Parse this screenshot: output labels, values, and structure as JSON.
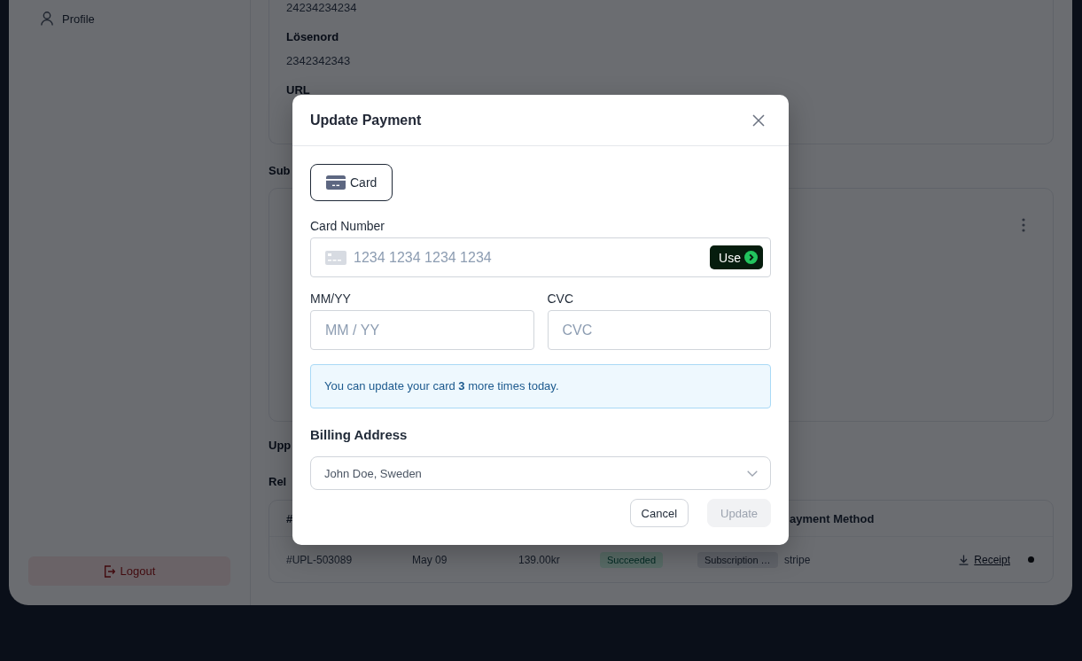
{
  "sidebar": {
    "items": [
      {
        "label": "Profile"
      }
    ],
    "logout_button": {
      "label": "Logout"
    }
  },
  "main": {
    "card_1": {
      "lines": [
        {
          "kind": "value",
          "text": "24234234234"
        },
        {
          "kind": "label",
          "text": "Lösenord"
        },
        {
          "kind": "value",
          "text": "2342342343"
        },
        {
          "kind": "label",
          "text": "URL"
        }
      ]
    },
    "heading_2": "Sub",
    "heading_3": "Upp",
    "heading_4": "Rel",
    "table": {
      "columns": [
        {
          "kind": "number",
          "label": "#"
        },
        {
          "kind": "payment_method",
          "label": "ayment Method"
        }
      ],
      "rows": [
        {
          "number": "#UPL-503089",
          "date": "May 09",
          "amount": "139.00kr",
          "status": "Succeeded",
          "type": "Subscription …",
          "method": "stripe",
          "receipt": "Receipt"
        }
      ]
    }
  },
  "modal": {
    "title": "Update Payment",
    "methods": [
      {
        "label": "Card",
        "selected": true
      }
    ],
    "card_number": {
      "label": "Card Number",
      "placeholder": "1234 1234 1234 1234",
      "action": "Use"
    },
    "expiry": {
      "label": "MM/YY",
      "placeholder": "MM / YY"
    },
    "cvc": {
      "label": "CVC",
      "placeholder": "CVC"
    },
    "notice": "You can update your card **3** more times today.",
    "billing": {
      "label": "Billing Address",
      "value": "John Doe, Sweden"
    },
    "buttons": [
      {
        "label": "Cancel",
        "disabled": false
      },
      {
        "label": "Update",
        "disabled": true
      }
    ]
  }
}
